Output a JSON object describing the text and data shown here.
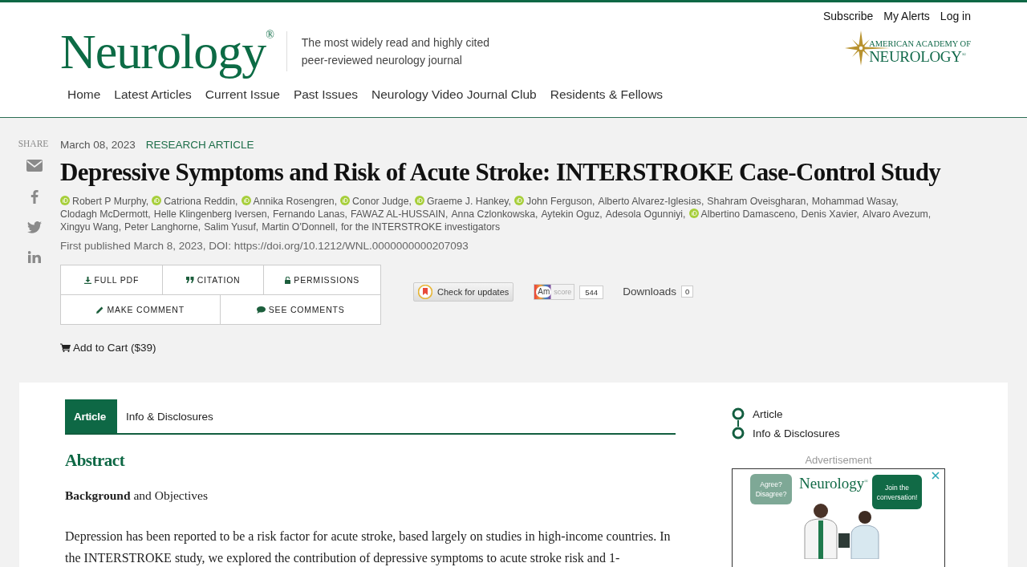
{
  "top_links": [
    "Subscribe",
    "My Alerts",
    "Log in"
  ],
  "logo": "Neurology$^{®}$",
  "tagline": "The most widely read and highly cited peer-reviewed neurology journal",
  "aan_logo": {
    "line1": "AMERICAN ACADEMY OF",
    "line2": "NEUROLOGY$^{®}$"
  },
  "nav": [
    "Home",
    "Latest Articles",
    "Current Issue",
    "Past Issues",
    "Neurology Video Journal Club",
    "Residents & Fellows"
  ],
  "share": {
    "label": "SHARE",
    "icons": [
      {
        "kind": "email"
      },
      {
        "kind": "facebook"
      },
      {
        "kind": "twitter"
      },
      {
        "kind": "linkedin"
      }
    ]
  },
  "article": {
    "date": "March 08, 2023",
    "type": "RESEARCH ARTICLE",
    "title": "Depressive Symptoms and Risk of Acute Stroke: INTERSTROKE Case-Control Study",
    "authors": [
      {
        "name": "Robert P Murphy,",
        "orcid": true
      },
      {
        "name": "Catriona Reddin,",
        "orcid": true
      },
      {
        "name": "Annika Rosengren,",
        "orcid": true
      },
      {
        "name": "Conor Judge,",
        "orcid": true
      },
      {
        "name": "Graeme J. Hankey,",
        "orcid": true
      },
      {
        "name": "John Ferguson,",
        "orcid": true
      },
      {
        "name": "Alberto Alvarez-Iglesias,",
        "orcid": false
      },
      {
        "name": "Shahram Oveisgharan,",
        "orcid": false
      },
      {
        "name": "Mohammad Wasay,",
        "orcid": false
      },
      {
        "name": "Clodagh McDermott,",
        "orcid": false
      },
      {
        "name": "Helle Klingenberg Iversen,",
        "orcid": false
      },
      {
        "name": "Fernando Lanas,",
        "orcid": false
      },
      {
        "name": "FAWAZ AL-HUSSAIN,",
        "orcid": false
      },
      {
        "name": "Anna Czlonkowska,",
        "orcid": false
      },
      {
        "name": "Aytekin Oguz,",
        "orcid": false
      },
      {
        "name": "Adesola Ogunniyi,",
        "orcid": false
      },
      {
        "name": "Albertino Damasceno,",
        "orcid": true
      },
      {
        "name": "Denis Xavier,",
        "orcid": false
      },
      {
        "name": "Alvaro Avezum,",
        "orcid": false
      },
      {
        "name": "Xingyu Wang,",
        "orcid": false
      },
      {
        "name": "Peter Langhorne,",
        "orcid": false
      },
      {
        "name": "Salim Yusuf,",
        "orcid": false
      },
      {
        "name": "Martin O'Donnell,",
        "orcid": false
      },
      {
        "name": "for the INTERSTROKE investigators",
        "orcid": false
      }
    ],
    "published": "First published March 8, 2023, DOI: https://doi.org/10.1212/WNL.0000000000207093"
  },
  "action_rows": [
    [
      {
        "label": "FULL PDF",
        "kind": "download"
      },
      {
        "label": "CITATION",
        "kind": "citation"
      },
      {
        "label": "PERMISSIONS",
        "kind": "permissions"
      }
    ],
    [
      {
        "label": "MAKE COMMENT",
        "kind": "comment"
      },
      {
        "label": "SEE COMMENTS",
        "kind": "comments"
      }
    ]
  ],
  "check_updates": "Check for updates",
  "altmetric": {
    "badge": "Am",
    "label": "score",
    "count": "544"
  },
  "downloads": {
    "label": "Downloads",
    "count": "0"
  },
  "cart": "Add to Cart ($39)",
  "tabs": [
    {
      "label": "Article",
      "selected": true
    },
    {
      "label": "Info & Disclosures",
      "selected": false
    }
  ],
  "abstract": {
    "heading": "Abstract",
    "subheading": "**Background** and Objectives",
    "text": "Depression has been reported to be a risk factor for acute stroke, based largely on studies in high-income countries. In the INTERSTROKE study, we explored the contribution of depressive symptoms to acute stroke risk and 1-"
  },
  "toc": [
    "Article",
    "Info & Disclosures"
  ],
  "ad": {
    "label": "Advertisement",
    "brand": "Neurology$^{®}$",
    "bubble_left": "Agree? Disagree?",
    "bubble_right": "Join the conversation!"
  }
}
